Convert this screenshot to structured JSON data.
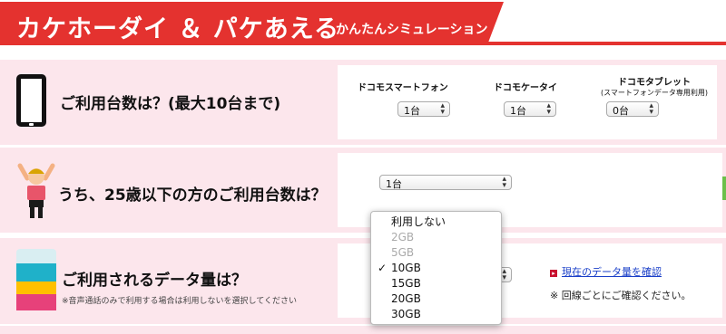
{
  "header": {
    "title": "カケホーダイ ＆ パケあえる",
    "subtitle": "かんたんシミュレーション"
  },
  "q1": {
    "label": "ご利用台数は？(最大10台まで)",
    "columns": [
      {
        "label": "ドコモスマートフォン",
        "sublabel": "",
        "value": "1台"
      },
      {
        "label": "ドコモケータイ",
        "sublabel": "",
        "value": "1台"
      },
      {
        "label": "ドコモタブレット",
        "sublabel": "(スマートフォンデータ専用利用)",
        "value": "0台"
      }
    ]
  },
  "q2": {
    "label": "うち、25歳以下の方のご利用台数は？",
    "value": "1台"
  },
  "q3": {
    "label": "ご利用されるデータ量は？",
    "note": "※音声通話のみで利用する場合は利用しないを選択してください",
    "options": [
      {
        "label": "利用しない",
        "disabled": false,
        "checked": false
      },
      {
        "label": "2GB",
        "disabled": true,
        "checked": false
      },
      {
        "label": "5GB",
        "disabled": true,
        "checked": false
      },
      {
        "label": "10GB",
        "disabled": false,
        "checked": true
      },
      {
        "label": "15GB",
        "disabled": false,
        "checked": false
      },
      {
        "label": "20GB",
        "disabled": false,
        "checked": false
      },
      {
        "label": "30GB",
        "disabled": false,
        "checked": false
      }
    ],
    "link": "現在のデータ量を確認",
    "confirm_note": "※ 回線ごとにご確認ください。",
    "check_mark": "✓"
  },
  "colors": {
    "accent": "#e4322f",
    "row_bg": "#fce6ec",
    "link": "#1a3fc8"
  },
  "icons": {
    "device": "smartphone-icon",
    "person": "kid-cheering-icon",
    "data": "data-stack-icon"
  }
}
